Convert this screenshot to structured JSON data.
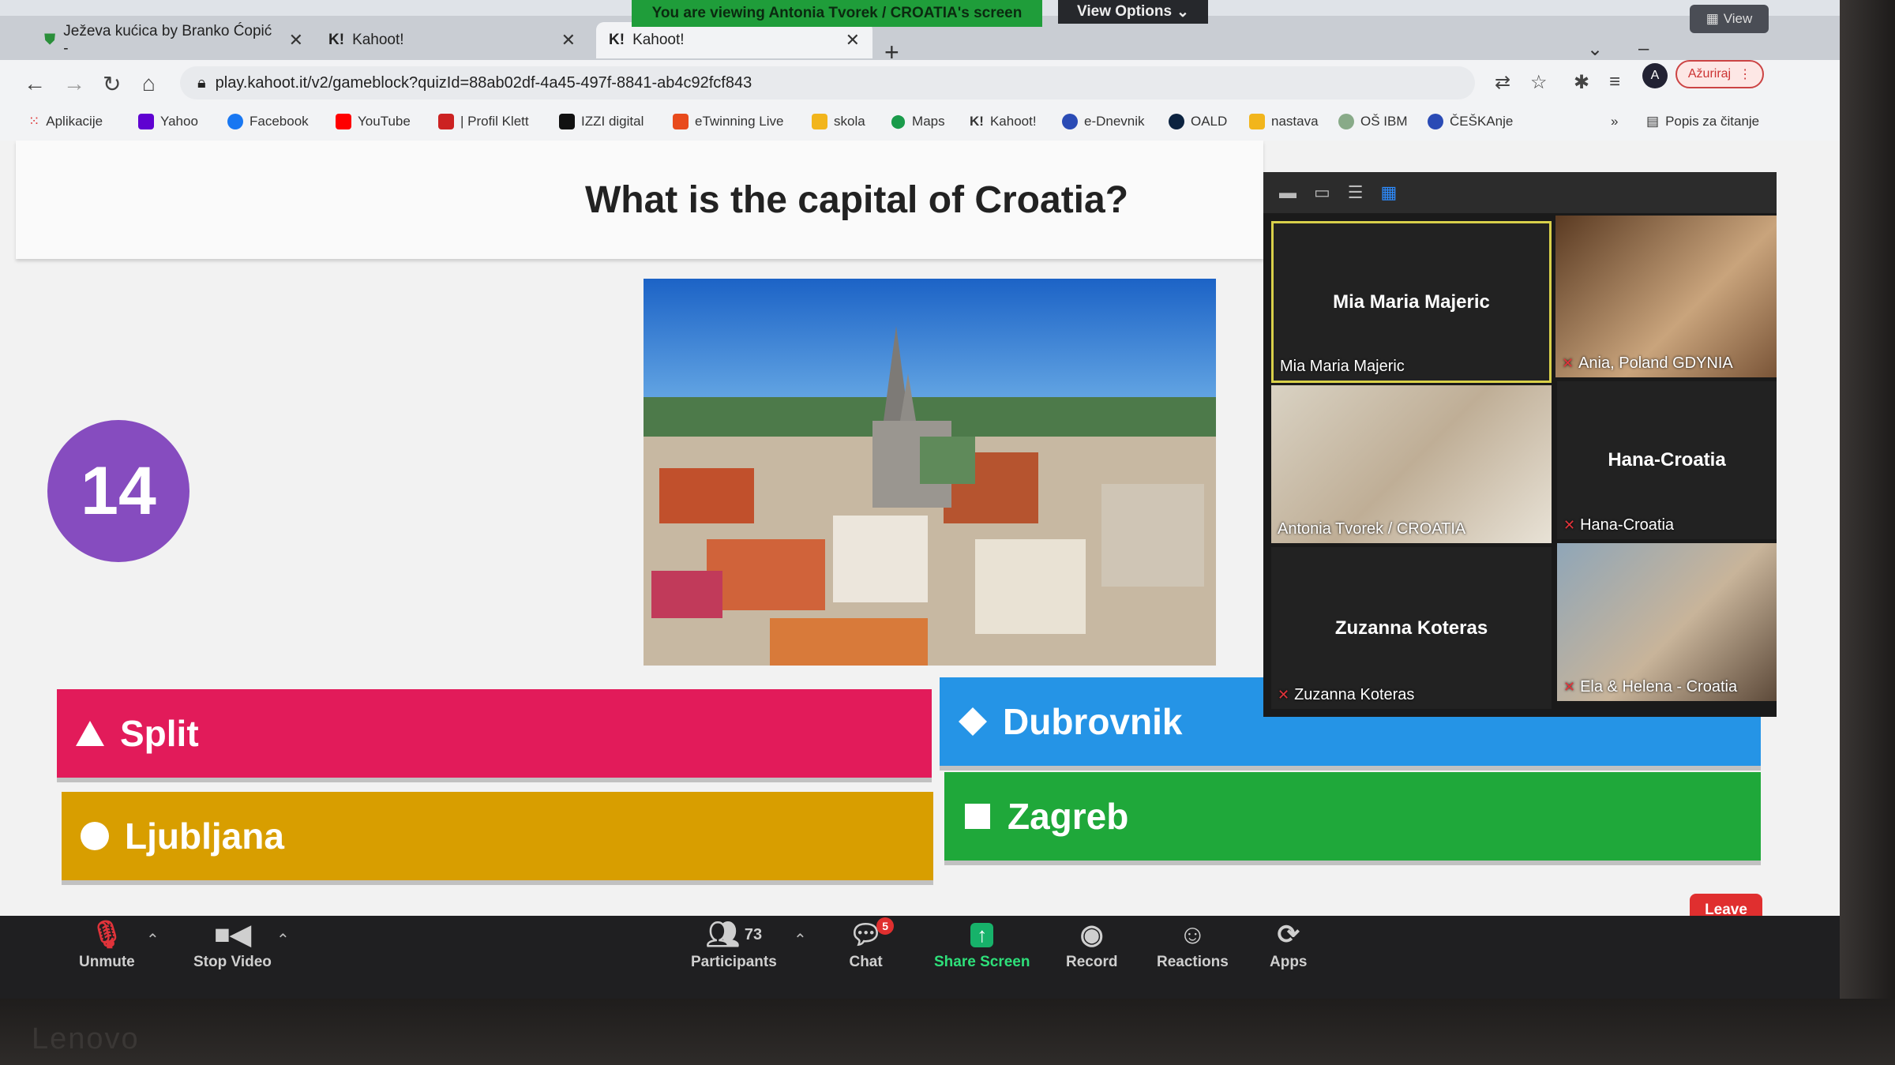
{
  "zoom": {
    "share_banner": "You are viewing Antonia Tvorek / CROATIA's screen",
    "view_options": "View Options",
    "view_button": "View",
    "toolbar": {
      "unmute": "Unmute",
      "stop_video": "Stop Video",
      "participants": "Participants",
      "participants_count": "73",
      "chat": "Chat",
      "chat_badge": "5",
      "share_screen": "Share Screen",
      "record": "Record",
      "reactions": "Reactions",
      "apps": "Apps",
      "leave": "Leave"
    },
    "gallery": [
      {
        "name": "Mia Maria Majeric",
        "overlay": "Mia Maria Majeric",
        "video": false
      },
      {
        "name": "Ania, Poland GDYNIA",
        "overlay": "",
        "video": true
      },
      {
        "name": "Antonia Tvorek / CROATIA",
        "overlay": "",
        "video": true
      },
      {
        "name": "Hana-Croatia",
        "overlay": "Hana-Croatia",
        "video": false
      },
      {
        "name": "Zuzanna Koteras",
        "overlay": "Zuzanna Koteras",
        "video": false
      },
      {
        "name": "Ela & Helena - Croatia",
        "overlay": "",
        "video": true
      }
    ]
  },
  "browser": {
    "tabs": [
      {
        "title": "Ježeva kućica by Branko Ćopić -"
      },
      {
        "title": "Kahoot!"
      },
      {
        "title": "Kahoot!"
      }
    ],
    "url": "play.kahoot.it/v2/gameblock?quizId=88ab02df-4a45-497f-8841-ab4c92fcf843",
    "update_button": "Ažuriraj",
    "profile_initial": "A",
    "bookmarks": [
      "Aplikacije",
      "Yahoo",
      "Facebook",
      "YouTube",
      "| Profil Klett",
      "IZZI digital",
      "eTwinning Live",
      "skola",
      "Maps",
      "Kahoot!",
      "e-Dnevnik",
      "OALD",
      "nastava",
      "OŠ IBM",
      "ČEŠKAnje"
    ],
    "reading_list": "Popis za čitanje",
    "more": "»"
  },
  "kahoot": {
    "question": "What is the capital of Croatia?",
    "timer": "14",
    "answers": [
      {
        "label": "Split",
        "color": "#e21b5a",
        "shape": "triangle"
      },
      {
        "label": "Dubrovnik",
        "color": "#2594e6",
        "shape": "diamond"
      },
      {
        "label": "Ljubljana",
        "color": "#d89e00",
        "shape": "circle"
      },
      {
        "label": "Zagreb",
        "color": "#1fa83a",
        "shape": "square"
      }
    ]
  },
  "device": {
    "brand": "Lenovo"
  }
}
